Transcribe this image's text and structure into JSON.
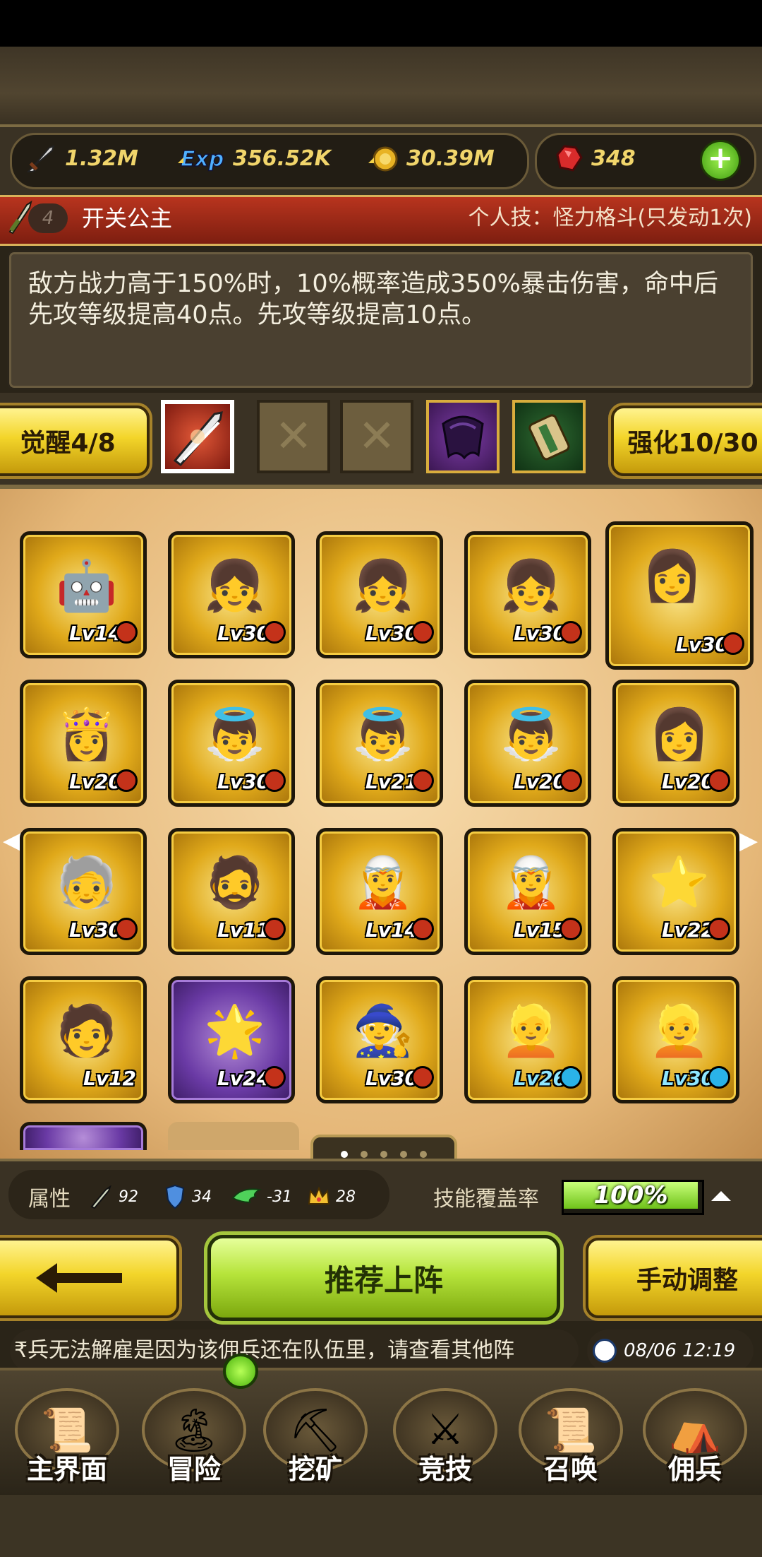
{
  "resources": {
    "attack": "1.32M",
    "exp": "356.52K",
    "coins": "30.39M",
    "gems": "348"
  },
  "hero": {
    "level_badge": "4",
    "name": "开关公主",
    "skill": "个人技：怪力格斗(只发动1次)",
    "description": "敌方战力高于150%时，10%概率造成350%暴击伤害，命中后先攻等级提高40点。先攻等级提高10点。"
  },
  "awaken_label": "觉醒4/8",
  "strengthen_label": "强化10/30",
  "equip_slots": [
    "sword",
    "empty",
    "empty",
    "cape",
    "scroll"
  ],
  "grid": {
    "rows": [
      [
        {
          "level": "Lv14",
          "icon": "robot-hero",
          "frame": "gold",
          "badge": "red"
        },
        {
          "level": "Lv30",
          "icon": "girl-hero",
          "frame": "gold",
          "badge": "red"
        },
        {
          "level": "Lv30",
          "icon": "girl-hero",
          "frame": "gold",
          "badge": "red"
        },
        {
          "level": "Lv30",
          "icon": "girl-hero",
          "frame": "gold",
          "badge": "red"
        },
        {
          "level": "Lv30",
          "icon": "red-hair-hero",
          "frame": "gold-selected",
          "badge": "red"
        }
      ],
      [
        {
          "level": "Lv20",
          "icon": "princess-hero",
          "frame": "gold",
          "badge": "red"
        },
        {
          "level": "Lv30",
          "icon": "angel-hero",
          "frame": "gold",
          "badge": "red"
        },
        {
          "level": "Lv21",
          "icon": "angel-hero",
          "frame": "gold",
          "badge": "red"
        },
        {
          "level": "Lv20",
          "icon": "angel-hero",
          "frame": "gold",
          "badge": "red"
        },
        {
          "level": "Lv20",
          "icon": "purple-hair-hero",
          "frame": "gold",
          "badge": "red"
        }
      ],
      [
        {
          "level": "Lv30",
          "icon": "white-hair-hero",
          "frame": "gold",
          "badge": "red"
        },
        {
          "level": "Lv11",
          "icon": "blue-warrior-hero",
          "frame": "gold",
          "badge": "red"
        },
        {
          "level": "Lv14",
          "icon": "blonde-knight-hero",
          "frame": "gold",
          "badge": "red"
        },
        {
          "level": "Lv15",
          "icon": "blonde-knight-hero",
          "frame": "gold",
          "badge": "red"
        },
        {
          "level": "Lv22",
          "icon": "star-creature",
          "frame": "gold",
          "badge": "red"
        }
      ],
      [
        {
          "level": "Lv12",
          "icon": "orange-hair-hero",
          "frame": "gold",
          "badge": "none"
        },
        {
          "level": "Lv24",
          "icon": "starfish-creature",
          "frame": "purple",
          "badge": "red"
        },
        {
          "level": "Lv30",
          "icon": "bearded-sage",
          "frame": "gold",
          "badge": "red"
        },
        {
          "level": "Lv26",
          "icon": "blonde-girl",
          "frame": "gold",
          "badge": "blue"
        },
        {
          "level": "Lv30",
          "icon": "blonde-girl",
          "frame": "gold",
          "badge": "blue"
        }
      ]
    ]
  },
  "attributes": {
    "label": "属性",
    "attack": "92",
    "defense": "34",
    "speed": "-31",
    "crown": "28"
  },
  "coverage": {
    "label": "技能覆盖率",
    "value": "100%",
    "fraction": 1.0
  },
  "buttons": {
    "recommend": "推荐上阵",
    "manual": "手动调整"
  },
  "ticker": "₹兵无法解雇是因为该佣兵还在队伍里，请查看其他阵",
  "datetime": "08/06 12:19",
  "nav": [
    {
      "label": "主界面",
      "icon": "map-scroll-icon"
    },
    {
      "label": "冒险",
      "icon": "island-icon"
    },
    {
      "label": "挖矿",
      "icon": "pickaxe-icon"
    },
    {
      "label": "竞技",
      "icon": "crossed-swords-icon"
    },
    {
      "label": "召唤",
      "icon": "summon-scroll-icon"
    },
    {
      "label": "佣兵",
      "icon": "tent-icon"
    }
  ],
  "colors": {
    "gold": "#f3d52a",
    "green_button": "#b6e43b",
    "name_bar": "#b8341e",
    "gem": "#e23b3b"
  }
}
